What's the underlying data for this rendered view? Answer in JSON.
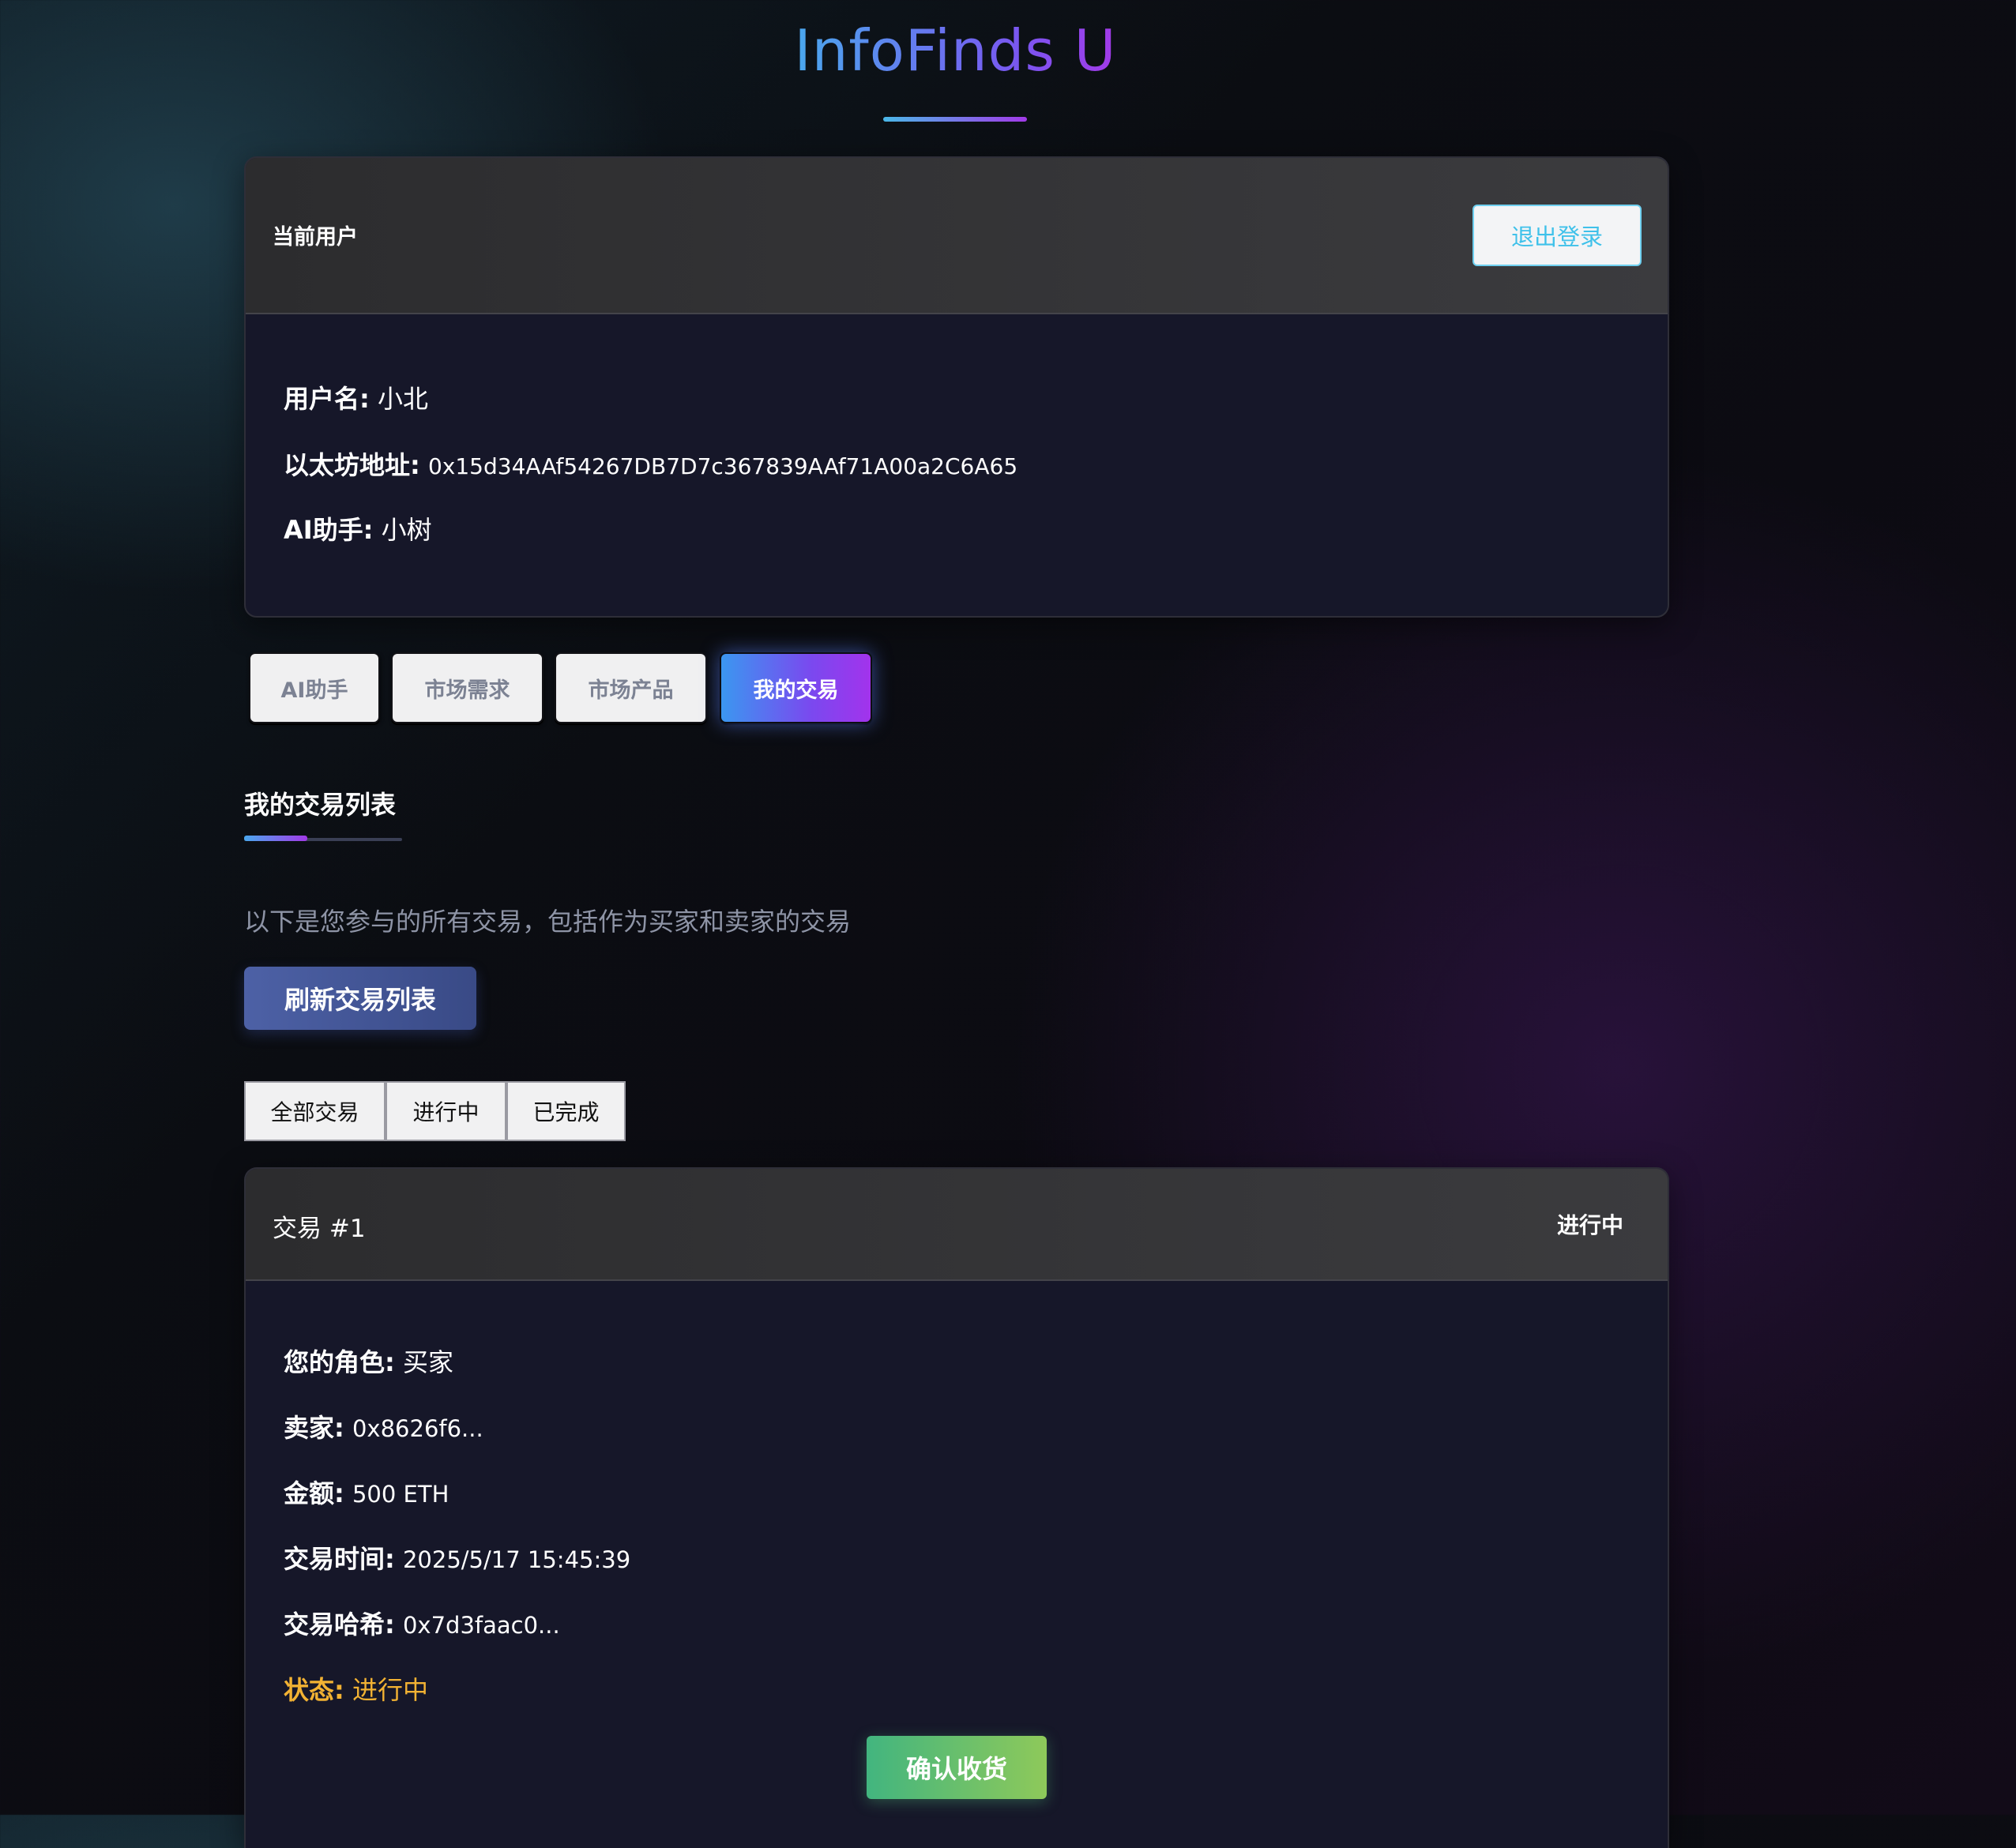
{
  "app": {
    "title": "InfoFinds U"
  },
  "user_card": {
    "header_label": "当前用户",
    "logout_label": "退出登录",
    "username_label": "用户名:",
    "username_value": "小北",
    "eth_label": "以太坊地址:",
    "eth_value": "0x15d34AAf54267DB7D7c367839AAf71A00a2C6A65",
    "assistant_label": "AI助手:",
    "assistant_value": "小树"
  },
  "tabs": [
    {
      "label": "AI助手",
      "active": false
    },
    {
      "label": "市场需求",
      "active": false
    },
    {
      "label": "市场产品",
      "active": false
    },
    {
      "label": "我的交易",
      "active": true
    }
  ],
  "transactions_section": {
    "title": "我的交易列表",
    "description": "以下是您参与的所有交易，包括作为买家和卖家的交易",
    "refresh_label": "刷新交易列表",
    "filters": [
      "全部交易",
      "进行中",
      "已完成"
    ]
  },
  "transaction": {
    "title": "交易 #1",
    "badge": "进行中",
    "role_label": "您的角色:",
    "role_value": "买家",
    "seller_label": "卖家:",
    "seller_value": "0x8626f6...",
    "amount_label": "金额:",
    "amount_value": "500 ETH",
    "time_label": "交易时间:",
    "time_value": "2025/5/17 15:45:39",
    "hash_label": "交易哈希:",
    "hash_value": "0x7d3faac0...",
    "status_label": "状态:",
    "status_value": "进行中",
    "confirm_label": "确认收货"
  },
  "colors": {
    "accent_gradient_start": "#3b97f0",
    "accent_gradient_end": "#a233ec",
    "status_pending": "#f2b233",
    "confirm_start": "#42b57f",
    "confirm_end": "#8ec95a",
    "logout_text": "#3fc1ea"
  }
}
